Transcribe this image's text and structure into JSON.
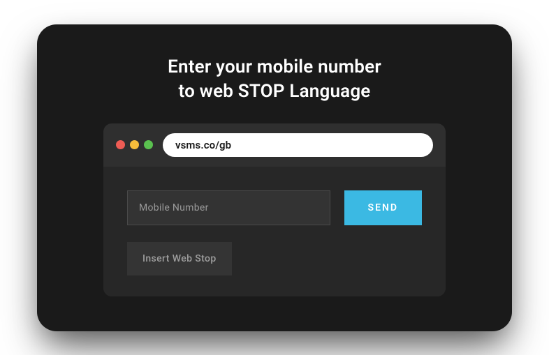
{
  "heading": {
    "line1": "Enter your mobile number",
    "line2": "to web STOP Language"
  },
  "browser": {
    "url": "vsms.co/gb",
    "dots": {
      "red": "#ee5c54",
      "yellow": "#f6bd3b",
      "green": "#5ac14f"
    }
  },
  "form": {
    "mobile_placeholder": "Mobile Number",
    "send_label": "SEND",
    "insert_label": "Insert Web Stop"
  },
  "colors": {
    "accent": "#3bb9e3",
    "card_bg": "#1a1a1a",
    "panel_bg": "#2f2f2f",
    "body_bg": "#272727"
  }
}
